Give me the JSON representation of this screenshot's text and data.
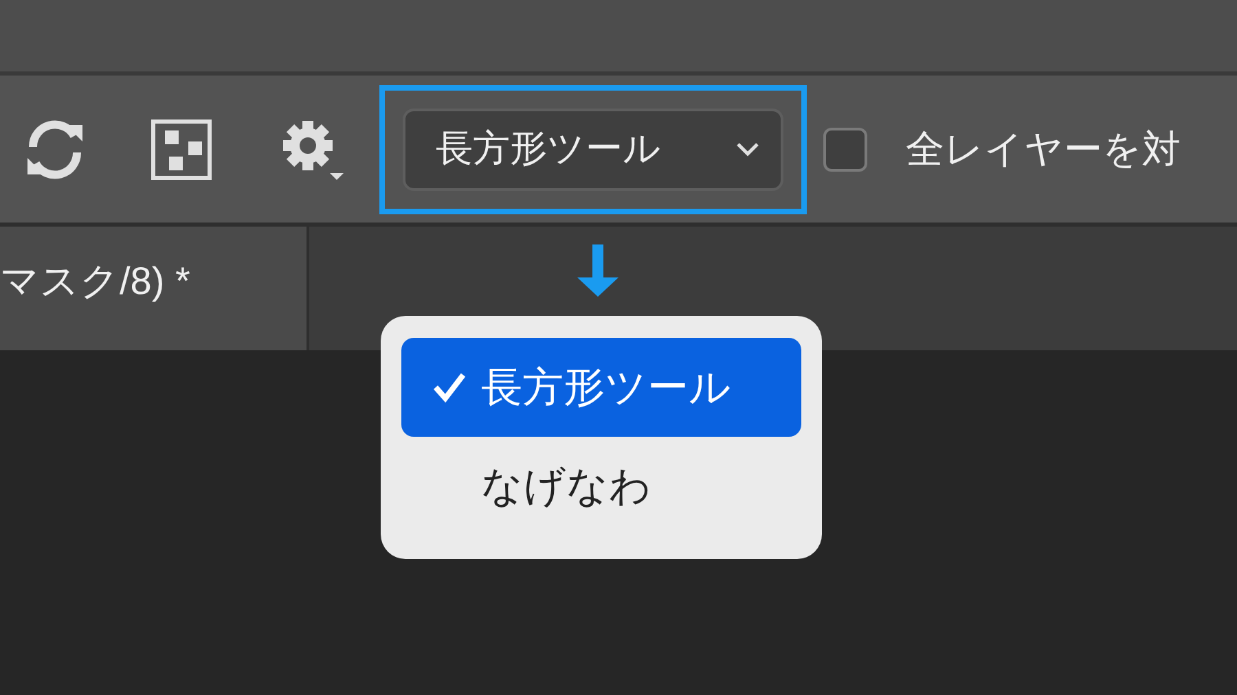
{
  "tool_dropdown": {
    "value": "長方形ツール",
    "highlighted": true
  },
  "all_layers_checkbox": {
    "label": "全レイヤーを対",
    "checked": false
  },
  "document_tab": {
    "label": "マスク/8) *"
  },
  "dropdown_menu": {
    "items": [
      {
        "label": "長方形ツール",
        "selected": true
      },
      {
        "label": "なげなわ",
        "selected": false
      }
    ]
  }
}
